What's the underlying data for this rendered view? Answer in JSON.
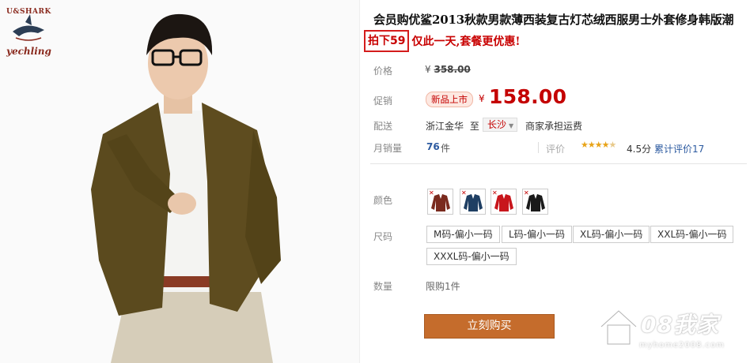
{
  "brand": {
    "logo_top": "U&SHARK",
    "logo_script": "yechling"
  },
  "product": {
    "title": "会员购优鲨2013秋款男款薄西装复古灯芯绒西服男士外套修身韩版潮",
    "promo_box": "拍下59",
    "promo_text": "仅此一天,套餐更优惠!"
  },
  "price": {
    "label": "价格",
    "currency": "¥",
    "original": "358.00"
  },
  "promotion": {
    "label": "促销",
    "badge": "新品上市",
    "currency": "¥",
    "price": "158.00",
    "accent_color": "#c40000"
  },
  "shipping": {
    "label": "配送",
    "from": "浙江金华",
    "to_prefix": "至",
    "to_city": "长沙",
    "fee_note": "商家承担运费"
  },
  "sales": {
    "label": "月销量",
    "count": "76",
    "unit": "件",
    "rating_label": "评价",
    "stars_value": 4.5,
    "score": "4.5分",
    "reviews": "累计评价17"
  },
  "colors": {
    "label": "颜色",
    "swatches": [
      {
        "name": "brown-jacket",
        "color": "#7a2a1e"
      },
      {
        "name": "navy-jacket",
        "color": "#1f3f63"
      },
      {
        "name": "red-jacket",
        "color": "#c8161c"
      },
      {
        "name": "black-jacket",
        "color": "#1a1a1a"
      }
    ]
  },
  "sizes": {
    "label": "尺码",
    "options": [
      "M码-偏小一码",
      "L码-偏小一码",
      "XL码-偏小一码",
      "XXL码-偏小一码",
      "XXXL码-偏小一码"
    ]
  },
  "quantity": {
    "label": "数量",
    "limit": "限购1件"
  },
  "buy_button": {
    "label": "立刻购买",
    "color": "#c56c2c"
  },
  "watermark": {
    "text": "08我家",
    "url": "myhome2008.com"
  }
}
